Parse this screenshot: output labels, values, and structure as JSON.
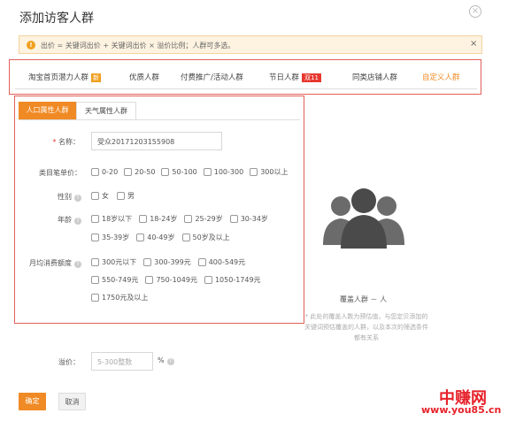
{
  "dialog": {
    "title": "添加访客人群",
    "close": "×"
  },
  "notice": {
    "icon": "!",
    "text": "出价 = 关键词出价 + 关键词出价 × 溢价比例；人群可多选。",
    "close": "×"
  },
  "tabs": [
    {
      "label": "淘宝首页潜力人群",
      "badge": "新"
    },
    {
      "label": "优质人群"
    },
    {
      "label": "付费推广/活动人群"
    },
    {
      "label": "节日人群",
      "badge": "双11"
    },
    {
      "label": "同类店铺人群"
    },
    {
      "label": "自定义人群",
      "active": true
    }
  ],
  "subtabs": [
    {
      "label": "人口属性人群",
      "active": true
    },
    {
      "label": "天气属性人群"
    }
  ],
  "form": {
    "name_label": "名称：",
    "name_required": "*",
    "name_value": "受众20171203155908",
    "price_label": "类目笔单价：",
    "price_options": [
      "0-20",
      "20-50",
      "50-100",
      "100-300",
      "300以上"
    ],
    "gender_label": "性别",
    "gender_options": [
      "女",
      "男"
    ],
    "age_label": "年龄",
    "age_options_row1": [
      "18岁以下",
      "18-24岁",
      "25-29岁",
      "30-34岁"
    ],
    "age_options_row2": [
      "35-39岁",
      "40-49岁",
      "50岁及以上"
    ],
    "spend_label": "月均消费额度",
    "spend_options_row1": [
      "300元以下",
      "300-399元",
      "400-549元"
    ],
    "spend_options_row2": [
      "550-749元",
      "750-1049元",
      "1050-1749元"
    ],
    "spend_options_row3": [
      "1750元及以上"
    ]
  },
  "coverage": {
    "label": "覆盖人群 － 人",
    "note_line1": "* 此处的覆盖人数为预估值，与您定贝添加的",
    "note_line2": "关键词预估覆盖的人群，以及本次的筛选条件",
    "note_line3": "都有关系"
  },
  "premium": {
    "label": "溢价：",
    "placeholder": "5-300整数",
    "unit": "%"
  },
  "buttons": {
    "confirm": "确定",
    "cancel": "取消"
  },
  "watermark": {
    "line1": "中赚网",
    "line2": "www.you85.cn"
  },
  "colors": {
    "accent": "#f08a24",
    "highlight_box": "#e0605a",
    "notice_bg": "#fdf3e0"
  }
}
